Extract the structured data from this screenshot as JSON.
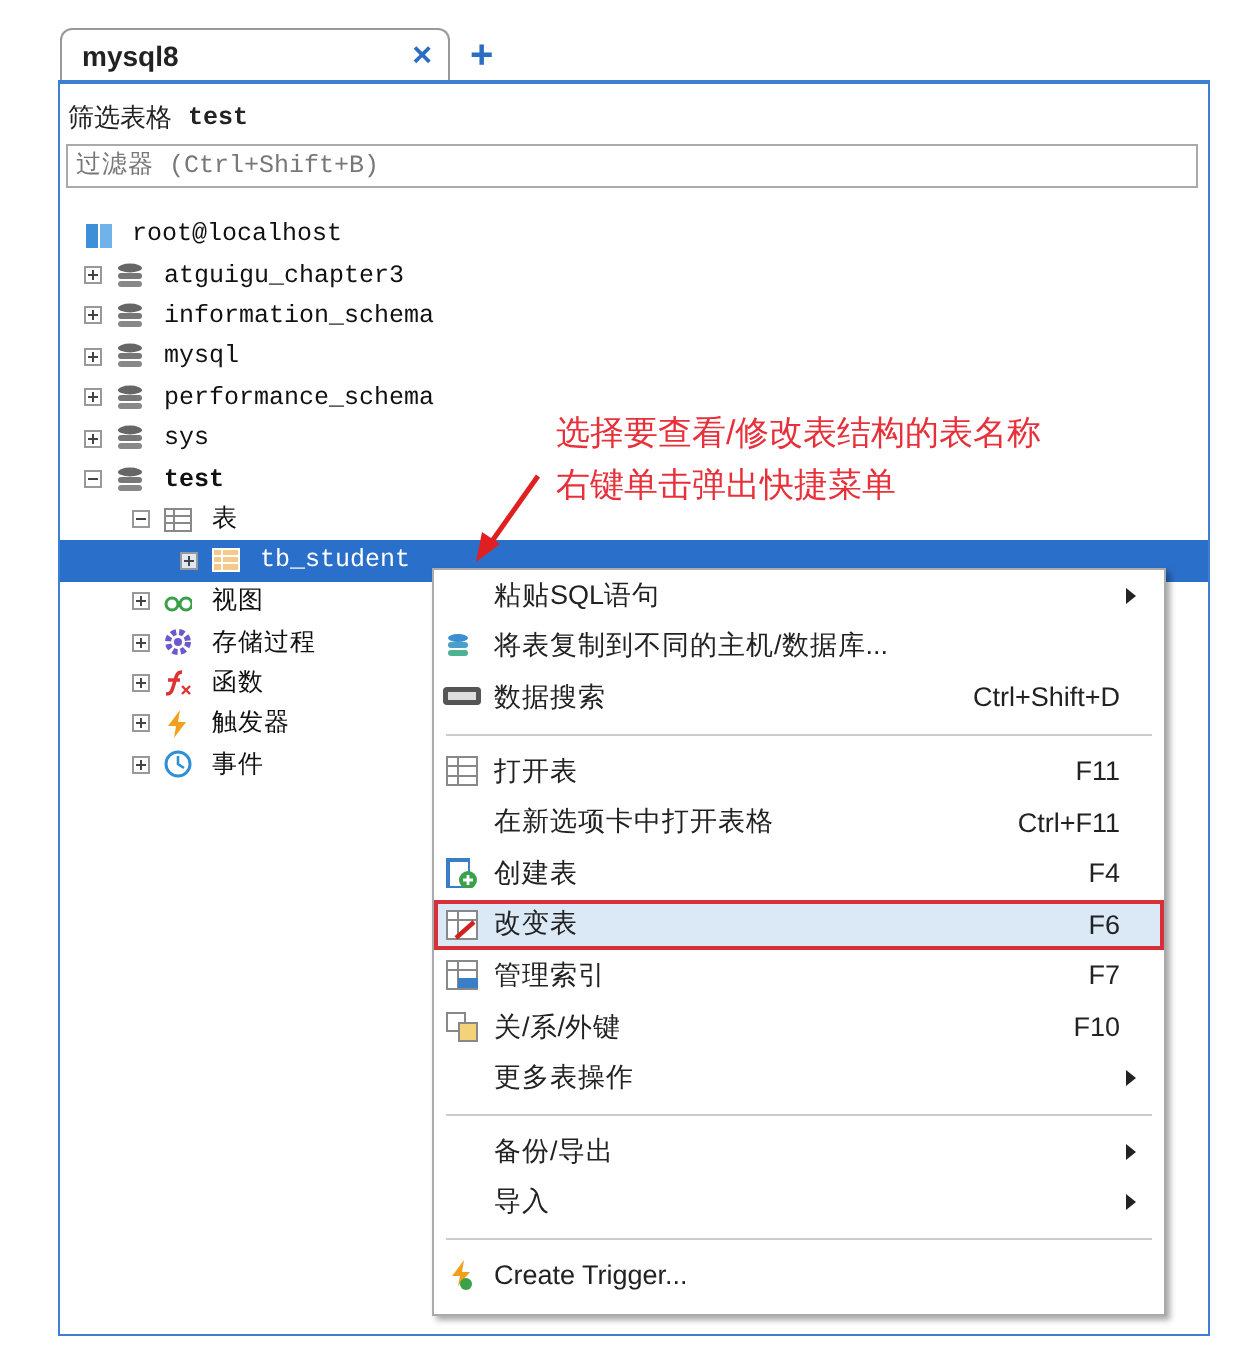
{
  "tabs": [
    {
      "label": "mysql8",
      "selected": true,
      "close": "×"
    }
  ],
  "new_tab": "+",
  "filter": {
    "label": "筛选表格",
    "value": "test",
    "placeholder": "过滤器 (Ctrl+Shift+B)"
  },
  "tree": [
    {
      "label": "root@localhost",
      "kind": "server",
      "selected": false,
      "children": [
        {
          "label": "atguigu_chapter3",
          "kind": "database",
          "expanded": false,
          "selected": false
        },
        {
          "label": "information_schema",
          "kind": "database",
          "expanded": false,
          "selected": false
        },
        {
          "label": "mysql",
          "kind": "database",
          "expanded": false,
          "selected": false
        },
        {
          "label": "performance_schema",
          "kind": "database",
          "expanded": false,
          "selected": false
        },
        {
          "label": "sys",
          "kind": "database",
          "expanded": false,
          "selected": false
        },
        {
          "label": "test",
          "kind": "database",
          "expanded": true,
          "selected": false,
          "bold": true,
          "children": [
            {
              "label": "表",
              "kind": "tables",
              "expanded": true,
              "selected": false,
              "children": [
                {
                  "label": "tb_student",
                  "kind": "table",
                  "expanded": false,
                  "selected": true
                }
              ]
            },
            {
              "label": "视图",
              "kind": "views",
              "expanded": false,
              "selected": false
            },
            {
              "label": "存储过程",
              "kind": "procedures",
              "expanded": false,
              "selected": false
            },
            {
              "label": "函数",
              "kind": "functions",
              "expanded": false,
              "selected": false
            },
            {
              "label": "触发器",
              "kind": "triggers",
              "expanded": false,
              "selected": false
            },
            {
              "label": "事件",
              "kind": "events",
              "expanded": false,
              "selected": false
            }
          ]
        }
      ]
    }
  ],
  "annotation": {
    "lines": [
      "选择要查看/修改表结构的表名称",
      "右键单击弹出快捷菜单"
    ]
  },
  "context_menu": [
    {
      "kind": "plain",
      "label": "粘贴SQL语句",
      "submenu": true,
      "selected": false
    },
    {
      "kind": "copy",
      "label": "将表复制到不同的主机/数据库...",
      "selected": false
    },
    {
      "kind": "search",
      "label": "数据搜索",
      "shortcut": "Ctrl+Shift+D",
      "selected": false
    },
    {
      "kind": "separator"
    },
    {
      "kind": "grid",
      "label": "打开表",
      "shortcut": "F11",
      "selected": false
    },
    {
      "kind": "plain",
      "label": "在新选项卡中打开表格",
      "shortcut": "Ctrl+F11",
      "selected": false
    },
    {
      "kind": "create",
      "label": "创建表",
      "shortcut": "F4",
      "selected": false
    },
    {
      "kind": "edit",
      "label": "改变表",
      "shortcut": "F6",
      "selected": true,
      "outlined": true
    },
    {
      "kind": "index",
      "label": "管理索引",
      "shortcut": "F7",
      "selected": false
    },
    {
      "kind": "relation",
      "label": "关/系/外键",
      "shortcut": "F10",
      "selected": false
    },
    {
      "kind": "plain",
      "label": "更多表操作",
      "submenu": true,
      "selected": false
    },
    {
      "kind": "separator"
    },
    {
      "kind": "plain",
      "label": "备份/导出",
      "submenu": true,
      "selected": false
    },
    {
      "kind": "plain",
      "label": "导入",
      "submenu": true,
      "selected": false
    },
    {
      "kind": "separator"
    },
    {
      "kind": "trigger",
      "label": "Create Trigger...",
      "selected": false
    }
  ]
}
